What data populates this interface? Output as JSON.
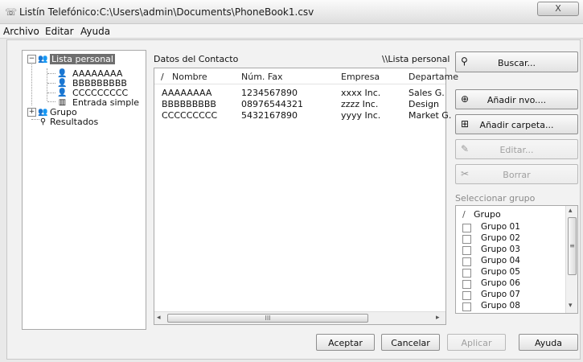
{
  "window": {
    "title": "Listín Telefónico:C:\\Users\\admin\\Documents\\PhoneBook1.csv",
    "close_glyph": "X"
  },
  "menu": {
    "items": [
      "Archivo",
      "Editar",
      "Ayuda"
    ]
  },
  "tree": {
    "root": "Lista personal",
    "children": [
      "AAAAAAAA",
      "BBBBBBBBB",
      "CCCCCCCCC",
      "Entrada simple"
    ],
    "group": "Grupo",
    "results": "Resultados"
  },
  "contacts": {
    "title": "Datos del Contacto",
    "path": "\\\\Lista personal",
    "columns": [
      "Nombre",
      "Núm. Fax",
      "Empresa",
      "Departame"
    ],
    "rows": [
      [
        "AAAAAAAA",
        "1234567890",
        "xxxx Inc.",
        "Sales G."
      ],
      [
        "BBBBBBBBB",
        "08976544321",
        "zzzz Inc.",
        "Design"
      ],
      [
        "CCCCCCCCC",
        "5432167890",
        "yyyy Inc.",
        "Market G."
      ]
    ],
    "scroll_thumb_glyph": "III"
  },
  "actions": {
    "buscar": "Buscar...",
    "anadir_nuevo": "Añadir nvo....",
    "anadir_carpeta": "Añadir carpeta...",
    "editar": "Editar...",
    "borrar": "Borrar"
  },
  "groups": {
    "label": "Seleccionar grupo",
    "header": "Grupo",
    "items": [
      "Grupo 01",
      "Grupo 02",
      "Grupo 03",
      "Grupo 04",
      "Grupo 05",
      "Grupo 06",
      "Grupo 07",
      "Grupo 08"
    ]
  },
  "footer": {
    "aceptar": "Aceptar",
    "cancelar": "Cancelar",
    "aplicar": "Aplicar",
    "ayuda": "Ayuda"
  }
}
